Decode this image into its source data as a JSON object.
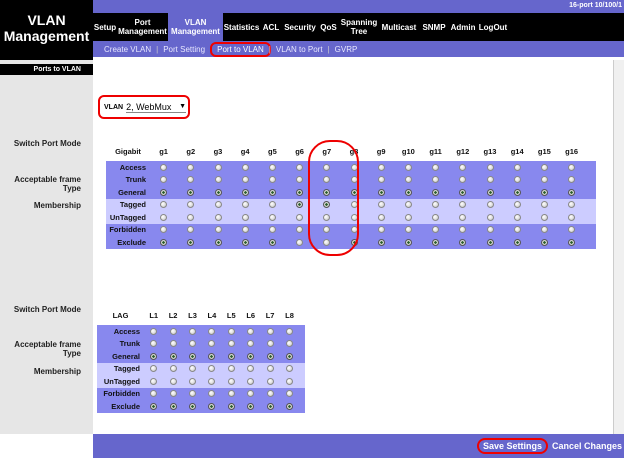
{
  "app": {
    "title_line1": "VLAN",
    "title_line2": "Management",
    "model": "16-port 10/100/1"
  },
  "nav": {
    "items": [
      {
        "label": "Setup",
        "active": false
      },
      {
        "label": "Port Management",
        "active": false
      },
      {
        "label": "VLAN Management",
        "active": true
      },
      {
        "label": "Statistics",
        "active": false
      },
      {
        "label": "ACL",
        "active": false
      },
      {
        "label": "Security",
        "active": false
      },
      {
        "label": "QoS",
        "active": false
      },
      {
        "label": "Spanning Tree",
        "active": false
      },
      {
        "label": "Multicast",
        "active": false
      },
      {
        "label": "SNMP",
        "active": false
      },
      {
        "label": "Admin",
        "active": false
      },
      {
        "label": "LogOut",
        "active": false
      }
    ]
  },
  "subnav": {
    "items": [
      {
        "label": "Create VLAN",
        "current": false
      },
      {
        "label": "Port Setting",
        "current": false
      },
      {
        "label": "Port to VLAN",
        "current": true
      },
      {
        "label": "VLAN to Port",
        "current": false
      },
      {
        "label": "GVRP",
        "current": false
      }
    ]
  },
  "sidebar": {
    "header": "Ports to VLAN"
  },
  "labels": {
    "switch_port_mode": "Switch Port Mode",
    "acceptable_frame_type": "Acceptable frame Type",
    "membership": "Membership"
  },
  "vlan": {
    "label": "VLAN",
    "selected": "2, WebMux"
  },
  "gigabit": {
    "header": "Gigabit",
    "ports": [
      "g1",
      "g2",
      "g3",
      "g4",
      "g5",
      "g6",
      "g7",
      "g8",
      "g9",
      "g10",
      "g11",
      "g12",
      "g13",
      "g14",
      "g15",
      "g16"
    ],
    "rows": [
      "Access",
      "Trunk",
      "General",
      "Tagged",
      "UnTagged",
      "Forbidden",
      "Exclude"
    ],
    "selected_mode": [
      "General",
      "General",
      "General",
      "General",
      "General",
      "General",
      "General",
      "General",
      "General",
      "General",
      "General",
      "General",
      "General",
      "General",
      "General",
      "General"
    ],
    "selected_membership": [
      "Exclude",
      "Exclude",
      "Exclude",
      "Exclude",
      "Exclude",
      "Tagged",
      "Tagged",
      "Exclude",
      "Exclude",
      "Exclude",
      "Exclude",
      "Exclude",
      "Exclude",
      "Exclude",
      "Exclude",
      "Exclude"
    ]
  },
  "lag": {
    "header": "LAG",
    "ports": [
      "L1",
      "L2",
      "L3",
      "L4",
      "L5",
      "L6",
      "L7",
      "L8"
    ],
    "rows": [
      "Access",
      "Trunk",
      "General",
      "Tagged",
      "UnTagged",
      "Forbidden",
      "Exclude"
    ],
    "selected_mode": [
      "General",
      "General",
      "General",
      "General",
      "General",
      "General",
      "General",
      "General"
    ],
    "selected_membership": [
      "Exclude",
      "Exclude",
      "Exclude",
      "Exclude",
      "Exclude",
      "Exclude",
      "Exclude",
      "Exclude"
    ]
  },
  "footer": {
    "save": "Save Settings",
    "cancel": "Cancel Changes"
  },
  "colors": {
    "nav_bg": "#000000",
    "accent": "#6666cc",
    "band_dark": "#8888ee",
    "band_light": "#ccccff",
    "highlight": "#ee0000"
  }
}
